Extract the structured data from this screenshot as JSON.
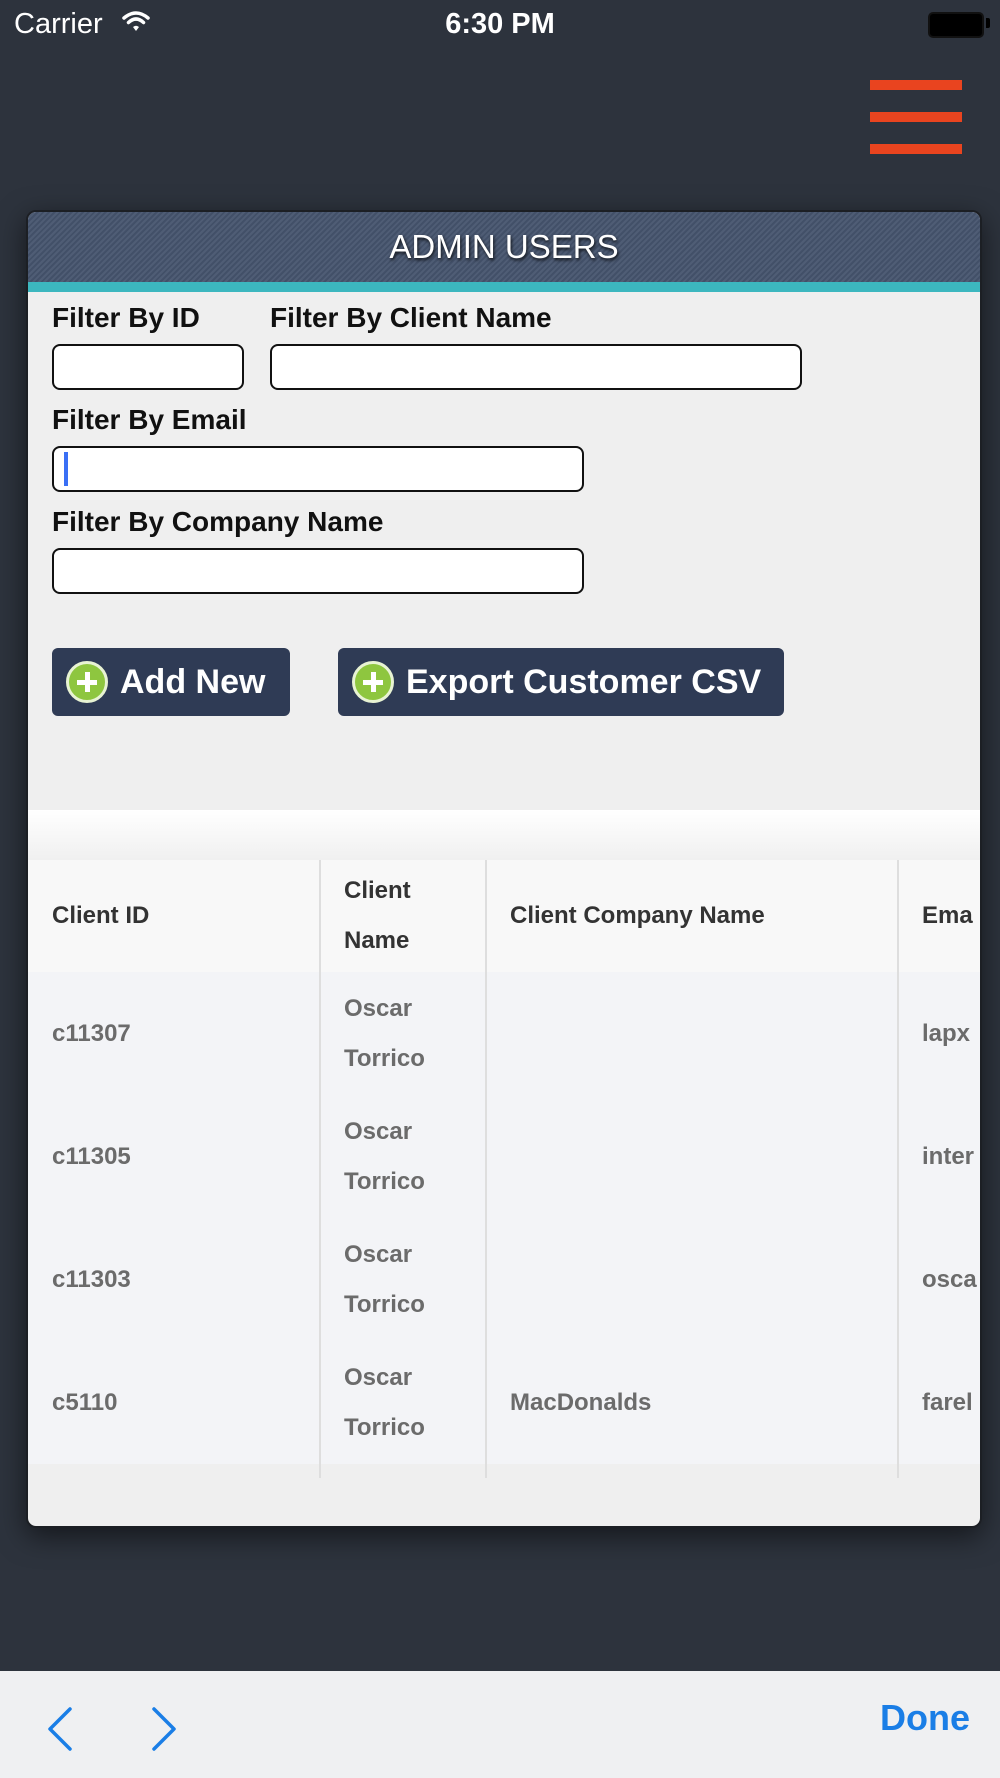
{
  "status_bar": {
    "carrier": "Carrier",
    "time": "6:30 PM"
  },
  "panel": {
    "title": "ADMIN USERS"
  },
  "filters": {
    "id_label": "Filter By ID",
    "client_name_label": "Filter By Client Name",
    "email_label": "Filter By Email",
    "company_label": "Filter By Company Name",
    "id_value": "",
    "client_name_value": "",
    "email_value": "",
    "company_value": ""
  },
  "buttons": {
    "add_new": "Add New",
    "export_csv": "Export Customer CSV"
  },
  "table": {
    "headers": [
      "Client ID",
      "Client Name",
      "Client Company Name",
      "Ema"
    ],
    "rows": [
      {
        "id": "c11307",
        "name": "Oscar Torrico",
        "company": "",
        "email": "lapx"
      },
      {
        "id": "c11305",
        "name": "Oscar Torrico",
        "company": "",
        "email": "inter"
      },
      {
        "id": "c11303",
        "name": "Oscar Torrico",
        "company": "",
        "email": "osca"
      },
      {
        "id": "c5110",
        "name": "Oscar Torrico",
        "company": "MacDonalds",
        "email": "farel"
      }
    ]
  },
  "toolbar": {
    "done": "Done"
  },
  "colors": {
    "accent": "#e9441f",
    "header": "#46546e",
    "teal": "#3cb7bf",
    "button": "#2f3b55",
    "link": "#1a7ee6"
  },
  "icons": [
    "wifi-icon",
    "battery-icon",
    "menu-icon",
    "plus-icon",
    "back-arrow-icon",
    "forward-arrow-icon"
  ]
}
